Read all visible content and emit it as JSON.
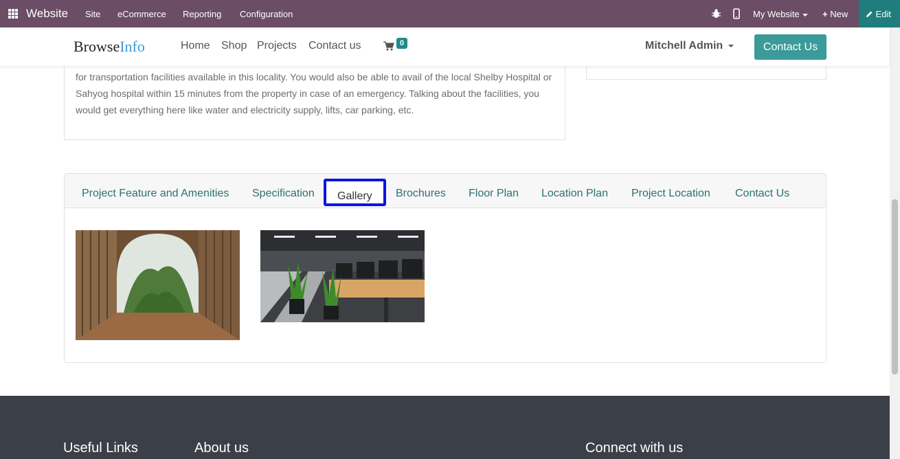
{
  "topbar": {
    "brand": "Website",
    "menu": [
      "Site",
      "eCommerce",
      "Reporting",
      "Configuration"
    ],
    "my_website": "My Website",
    "new_label": "New",
    "edit_label": "Edit",
    "colors": {
      "bar": "#6b4d66",
      "edit": "#1f7d7d"
    }
  },
  "header": {
    "logo_part1": "Browse",
    "logo_part2": "Info",
    "nav": [
      "Home",
      "Shop",
      "Projects",
      "Contact us"
    ],
    "cart_count": "0",
    "user": "Mitchell Admin",
    "contact_button": "Contact Us"
  },
  "description": {
    "text": "for transportation facilities available in this locality. You would also be able to avail of the local Shelby Hospital or Sahyog hospital within 15 minutes from the property in case of an emergency. Talking about the facilities, you would get everything here like water and electricity supply, lifts, car parking, etc."
  },
  "tabs": {
    "items": [
      "Project Feature and Amenities",
      "Specification",
      "Gallery",
      "Brochures",
      "Floor Plan",
      "Location Plan",
      "Project Location",
      "Contact Us"
    ],
    "active": "Gallery"
  },
  "footer": {
    "useful_links": "Useful Links",
    "about_us": "About us",
    "connect": "Connect with us"
  }
}
